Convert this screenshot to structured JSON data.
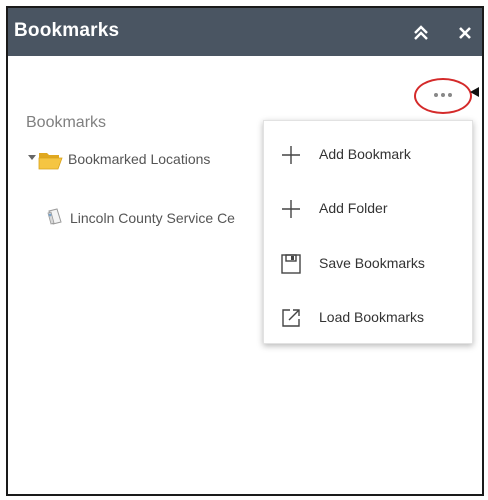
{
  "window": {
    "title": "Bookmarks",
    "title_bar_color": "#4a5562"
  },
  "icons": {
    "collapse": "double-chevron-up-icon",
    "close": "close-icon",
    "more": "ellipsis-icon",
    "folder": "folder-icon",
    "bookmark": "bookmark-document-icon"
  },
  "panel": {
    "section_label": "Bookmarks",
    "tree": {
      "folder": {
        "label": "Bookmarked Locations",
        "expanded": true,
        "items": [
          {
            "label": "Lincoln County Service Ce"
          }
        ]
      }
    }
  },
  "menu": {
    "items": [
      {
        "label": "Add Bookmark",
        "icon": "plus-icon"
      },
      {
        "label": "Add Folder",
        "icon": "plus-icon"
      },
      {
        "label": "Save Bookmarks",
        "icon": "save-icon"
      },
      {
        "label": "Load Bookmarks",
        "icon": "external-link-icon"
      }
    ]
  },
  "annotation": {
    "highlight_color": "#d42a2a"
  }
}
